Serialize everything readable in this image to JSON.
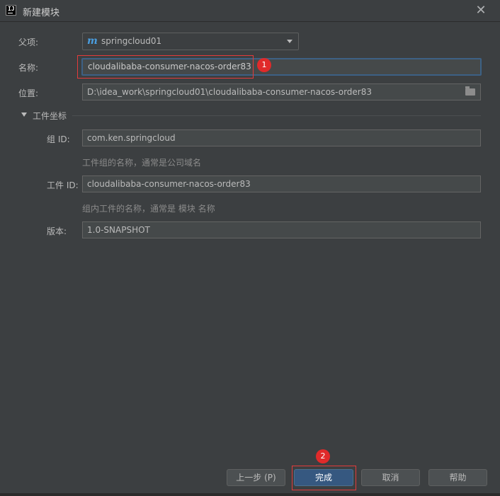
{
  "window": {
    "title": "新建模块"
  },
  "form": {
    "parent": {
      "label": "父项:",
      "icon_letter": "m",
      "value": "springcloud01"
    },
    "name": {
      "label": "名称:",
      "value": "cloudalibaba-consumer-nacos-order83"
    },
    "location": {
      "label": "位置:",
      "value": "D:\\idea_work\\springcloud01\\cloudalibaba-consumer-nacos-order83"
    },
    "artifact_section": {
      "title": "工件坐标",
      "group_id": {
        "label": "组 ID:",
        "value": "com.ken.springcloud",
        "hint": "工件组的名称，通常是公司域名"
      },
      "artifact_id": {
        "label": "工件 ID:",
        "value": "cloudalibaba-consumer-nacos-order83",
        "hint": "组内工件的名称，通常是 模块 名称"
      },
      "version": {
        "label": "版本:",
        "value": "1.0-SNAPSHOT"
      }
    }
  },
  "annotations": {
    "badge1": "1",
    "badge2": "2"
  },
  "buttons": {
    "prev": "上一步 (P)",
    "finish": "完成",
    "cancel": "取消",
    "help": "帮助"
  },
  "colors": {
    "accent": "#365880",
    "focus": "#3d6185",
    "callout": "#e02a2a"
  }
}
